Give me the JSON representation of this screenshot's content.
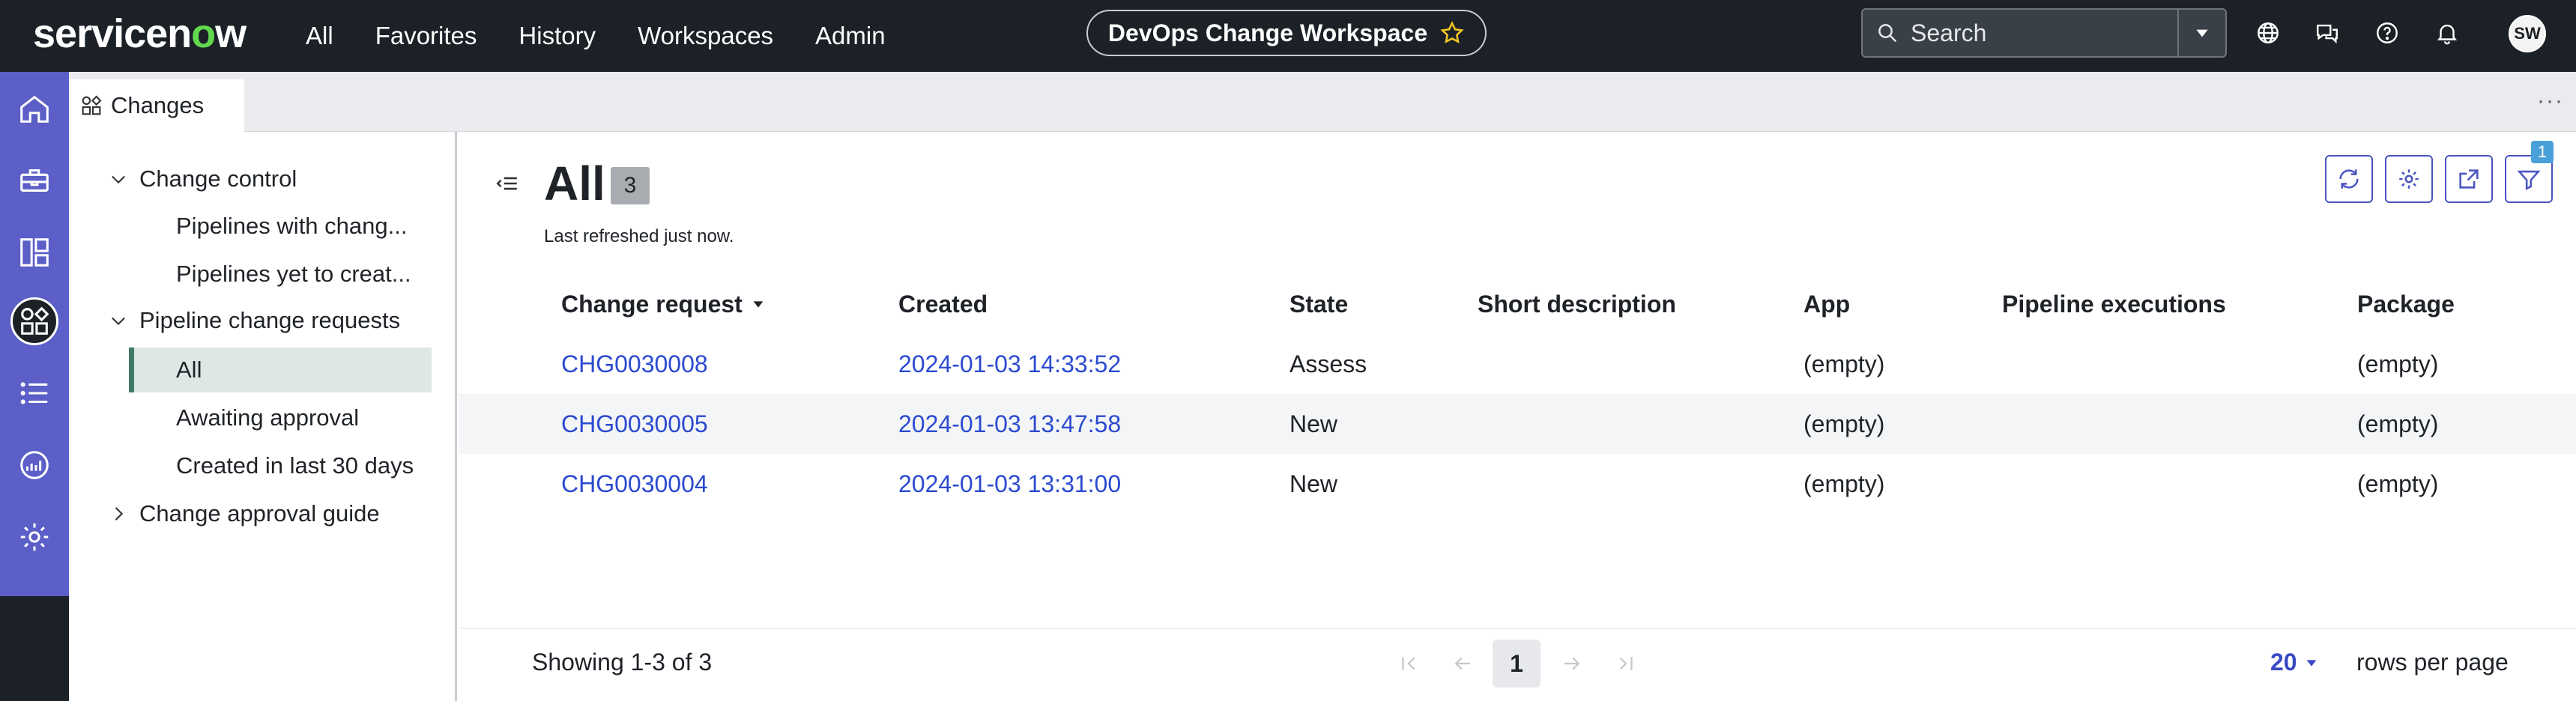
{
  "brand": {
    "logo_text": "servicenow"
  },
  "topnav": {
    "items": [
      "All",
      "Favorites",
      "History",
      "Workspaces",
      "Admin"
    ],
    "workspace_title": "DevOps Change Workspace",
    "search_placeholder": "Search",
    "avatar_initials": "SW"
  },
  "tabs": [
    {
      "label": "Changes"
    }
  ],
  "tree": {
    "items": [
      {
        "label": "Change control"
      },
      {
        "label": "Pipelines with chang..."
      },
      {
        "label": "Pipelines yet to creat..."
      },
      {
        "label": "Pipeline change requests"
      },
      {
        "label": "All"
      },
      {
        "label": "Awaiting approval"
      },
      {
        "label": "Created in last 30 days"
      },
      {
        "label": "Change approval guide"
      }
    ]
  },
  "main": {
    "title": "All",
    "count": "3",
    "last_refreshed": "Last refreshed just now.",
    "filter_badge": "1"
  },
  "table": {
    "columns": [
      "Change request",
      "Created",
      "State",
      "Short description",
      "App",
      "Pipeline executions",
      "Package"
    ],
    "rows": [
      [
        "CHG0030008",
        "2024-01-03 14:33:52",
        "Assess",
        "",
        "(empty)",
        "",
        "(empty)"
      ],
      [
        "CHG0030005",
        "2024-01-03 13:47:58",
        "New",
        "",
        "(empty)",
        "",
        "(empty)"
      ],
      [
        "CHG0030004",
        "2024-01-03 13:31:00",
        "New",
        "",
        "(empty)",
        "",
        "(empty)"
      ]
    ]
  },
  "pagination": {
    "showing": "Showing 1-3 of 3",
    "current_page": "1",
    "rows_per_page_value": "20",
    "rows_per_page_label": "rows per page"
  },
  "colors": {
    "topbar": "#1c2127",
    "rail_accent": "#5b5fc7",
    "link": "#2b4ad0",
    "brand_green": "#62d84e",
    "selected_row": "#dde8e4"
  }
}
